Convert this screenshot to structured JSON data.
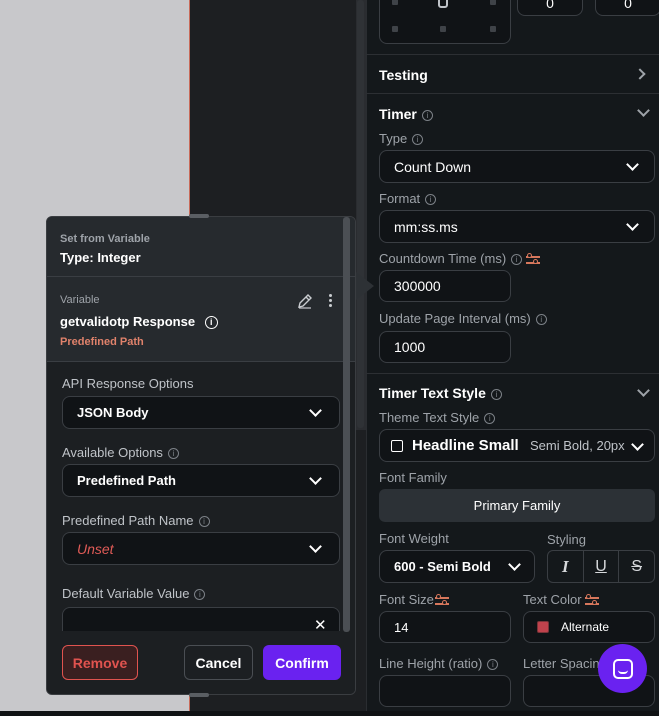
{
  "panel": {
    "top_inputs": [
      "0",
      "0"
    ],
    "testing": {
      "title": "Testing"
    },
    "timer": {
      "title": "Timer",
      "type_label": "Type",
      "type_value": "Count Down",
      "format_label": "Format",
      "format_value": "mm:ss.ms",
      "countdown_label": "Countdown Time (ms)",
      "countdown_value": "300000",
      "interval_label": "Update Page Interval (ms)",
      "interval_value": "1000"
    },
    "text_style": {
      "title": "Timer Text Style",
      "theme_label": "Theme Text Style",
      "theme_value": "Headline Small",
      "theme_meta": "Semi Bold, 20px",
      "font_family_label": "Font Family",
      "font_family_value": "Primary Family",
      "font_weight_label": "Font Weight",
      "font_weight_value": "600 - Semi Bold",
      "styling_label": "Styling",
      "italic_glyph": "I",
      "underline_glyph": "U",
      "strike_glyph": "S",
      "font_size_label": "Font Size",
      "font_size_value": "14",
      "text_color_label": "Text Color",
      "text_color_value": "Alternate",
      "text_color_swatch": "#c0424c",
      "line_height_label": "Line Height (ratio)",
      "letter_spacing_label": "Letter Spacing"
    }
  },
  "popup": {
    "title_small": "Set from Variable",
    "title_type": "Type: Integer",
    "variable_label": "Variable",
    "variable_name": "getvalidotp Response",
    "variable_path": "Predefined Path",
    "api_label": "API Response Options",
    "api_value": "JSON Body",
    "available_label": "Available Options",
    "available_value": "Predefined Path",
    "path_name_label": "Predefined Path Name",
    "path_name_value": "Unset",
    "default_label": "Default Variable Value",
    "remove_label": "Remove",
    "cancel_label": "Cancel",
    "confirm_label": "Confirm"
  },
  "colors": {
    "accent": "#6a22f0",
    "danger": "#e0534f",
    "warn_icon": "#d7775c",
    "bg": "#14181b"
  }
}
